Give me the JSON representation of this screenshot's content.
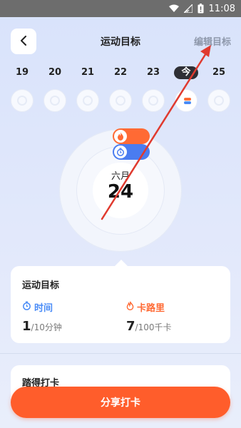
{
  "status_bar": {
    "time": "11:08"
  },
  "header": {
    "title": "运动目标",
    "edit_label": "编辑目标"
  },
  "dates": [
    {
      "label": "19",
      "today": false
    },
    {
      "label": "20",
      "today": false
    },
    {
      "label": "21",
      "today": false
    },
    {
      "label": "22",
      "today": false
    },
    {
      "label": "23",
      "today": false
    },
    {
      "label": "今",
      "today": true
    },
    {
      "label": "25",
      "today": false
    }
  ],
  "summary": {
    "month": "六月",
    "day": "24"
  },
  "goal_card": {
    "title": "运动目标",
    "time_label": "时间",
    "time_value": "1",
    "time_unit": "/10分钟",
    "calorie_label": "卡路里",
    "calorie_value": "7",
    "calorie_unit": "/100千卡"
  },
  "checkin_card": {
    "title": "踏得打卡"
  },
  "share_button": {
    "label": "分享打卡"
  },
  "colors": {
    "accent": "#ff5d2b",
    "time_blue": "#4a8cf7",
    "calorie_orange": "#ff6a34"
  }
}
